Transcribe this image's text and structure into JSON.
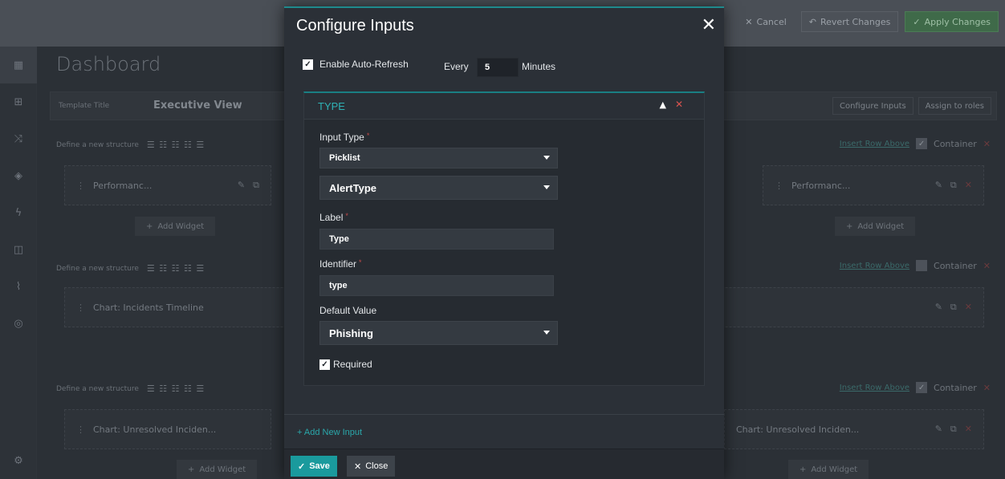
{
  "topbar": {
    "cancel_label": "Cancel",
    "revert_label": "Revert Changes",
    "apply_label": "Apply Changes"
  },
  "sidebar": {
    "icons": [
      "dashboard-icon",
      "templates-icon",
      "shuffle-icon",
      "shield-icon",
      "bolt-icon",
      "briefcase-icon",
      "chart-icon",
      "globe-icon",
      "settings-icon"
    ]
  },
  "dashboard": {
    "title": "Dashboard",
    "template_title_label": "Template Title",
    "template_title_value": "Executive View",
    "configure_inputs_label": "Configure Inputs",
    "assign_roles_label": "Assign to roles",
    "define_structure_label": "Define a new structure",
    "insert_row_above_label": "Insert Row Above",
    "container_label": "Container",
    "add_widget_label": "Add Widget",
    "widgets": {
      "perf_left": "Performanc...",
      "perf_right": "Performanc...",
      "incidents_timeline": "Chart: Incidents Timeline",
      "unresolved_left": "Chart: Unresolved Inciden...",
      "unresolved_right": "Chart: Unresolved Inciden..."
    }
  },
  "modal": {
    "title": "Configure Inputs",
    "auto_refresh_label": "Enable Auto-Refresh",
    "auto_refresh_checked": true,
    "every_label": "Every",
    "every_value": "5",
    "minutes_label": "Minutes",
    "panel": {
      "title": "TYPE",
      "input_type_label": "Input Type",
      "input_type_value": "Picklist",
      "picklist_value": "AlertType",
      "label_label": "Label",
      "label_value": "Type",
      "identifier_label": "Identifier",
      "identifier_value": "type",
      "default_value_label": "Default Value",
      "default_value": "Phishing",
      "required_label": "Required",
      "required_checked": true
    },
    "add_new_input_label": "Add New Input",
    "save_label": "Save",
    "close_label": "Close"
  },
  "colors": {
    "accent": "#1a9a9d",
    "panel_title": "#2fb2b5",
    "danger": "#d9534f"
  }
}
